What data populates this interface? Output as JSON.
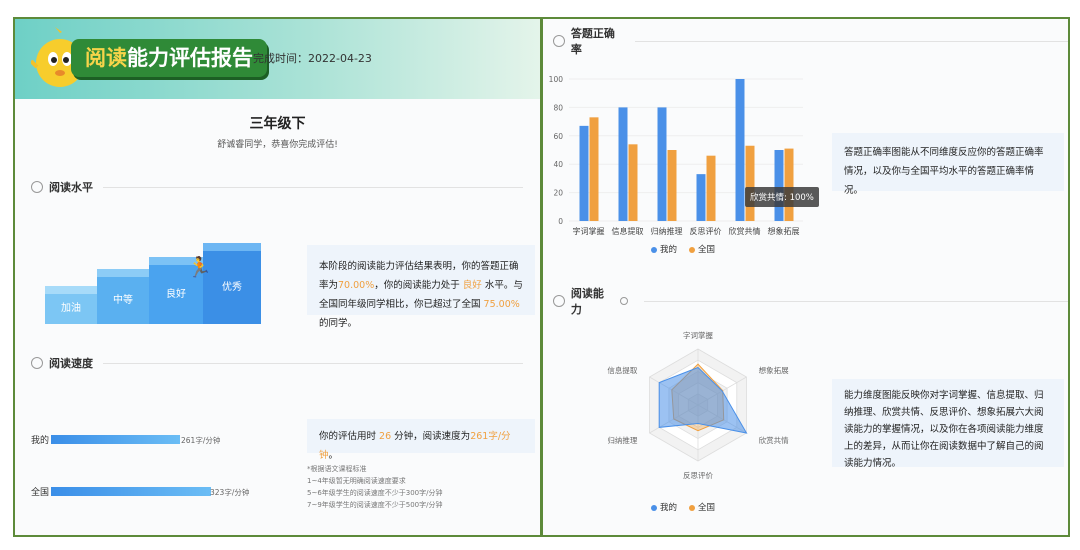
{
  "report": {
    "title_highlight": "阅读",
    "title_rest": "能力评估报告",
    "date_label": "完成时间：",
    "date_value": "2022-04-23",
    "grade": "三年级下",
    "greeting": "舒诚睿同学，恭喜你完成评估!"
  },
  "level": {
    "heading": "阅读水平",
    "steps": [
      "加油",
      "中等",
      "良好",
      "优秀"
    ],
    "text_1": "本阶段的阅读能力评估结果表明，你的答题正确率为",
    "accuracy": "70.00%",
    "text_2": "，你的阅读能力处于",
    "level_value": "良好",
    "text_3": "水平。与全国同年级同学相比，你已超过了全国",
    "percentile": "75.00%",
    "text_4": "的同学。"
  },
  "speed": {
    "heading": "阅读速度",
    "rows": [
      {
        "label": "我的",
        "value": "261字/分钟",
        "speed": 261
      },
      {
        "label": "全国",
        "value": "323字/分钟",
        "speed": 323
      }
    ],
    "box_1": "你的评估用时",
    "minutes": "26",
    "box_2": "分钟，阅读速度为",
    "speed_value": "261字/分钟",
    "box_3": "。",
    "notes": [
      "*根据语文课程标准",
      "1~4年级暂无明确阅读速度要求",
      "5~6年级学生的阅读速度不少于300字/分钟",
      "7~9年级学生的阅读速度不少于500字/分钟"
    ]
  },
  "accuracy_section": {
    "heading": "答题正确率",
    "description": "答题正确率图能从不同维度反应你的答题正确率情况，以及你与全国平均水平的答题正确率情况。",
    "tooltip": "欣赏共情: 100%"
  },
  "ability_section": {
    "heading": "阅读能力",
    "description": "能力维度图能反映你对字词掌握、信息提取、归纳推理、欣赏共情、反思评价、想象拓展六大阅读能力的掌握情况，以及你在各项阅读能力维度上的差异，从而让你在阅读数据中了解自己的阅读能力情况。"
  },
  "legend": {
    "mine": "我的",
    "national": "全国"
  },
  "colors": {
    "mine": "#4a90e8",
    "national": "#f0a040",
    "accent": "#2f8a37"
  },
  "chart_data": [
    {
      "type": "bar",
      "categories": [
        "字词掌握",
        "信息提取",
        "归纳推理",
        "反思评价",
        "欣赏共情",
        "想象拓展"
      ],
      "series": [
        {
          "name": "我的",
          "values": [
            67,
            80,
            80,
            33,
            100,
            50
          ]
        },
        {
          "name": "全国",
          "values": [
            73,
            54,
            50,
            46,
            53,
            51
          ]
        }
      ],
      "yticks": [
        "0",
        "20",
        "40",
        "60",
        "80",
        "100"
      ],
      "ylim": [
        0,
        100
      ],
      "legend": "bottom"
    },
    {
      "type": "radar",
      "categories": [
        "字词掌握",
        "想象拓展",
        "欣赏共情",
        "反思评价",
        "归纳推理",
        "信息提取"
      ],
      "series": [
        {
          "name": "我的",
          "values": [
            67,
            50,
            100,
            33,
            80,
            80
          ]
        },
        {
          "name": "全国",
          "values": [
            73,
            51,
            53,
            46,
            50,
            54
          ]
        }
      ],
      "legend": "bottom"
    }
  ]
}
